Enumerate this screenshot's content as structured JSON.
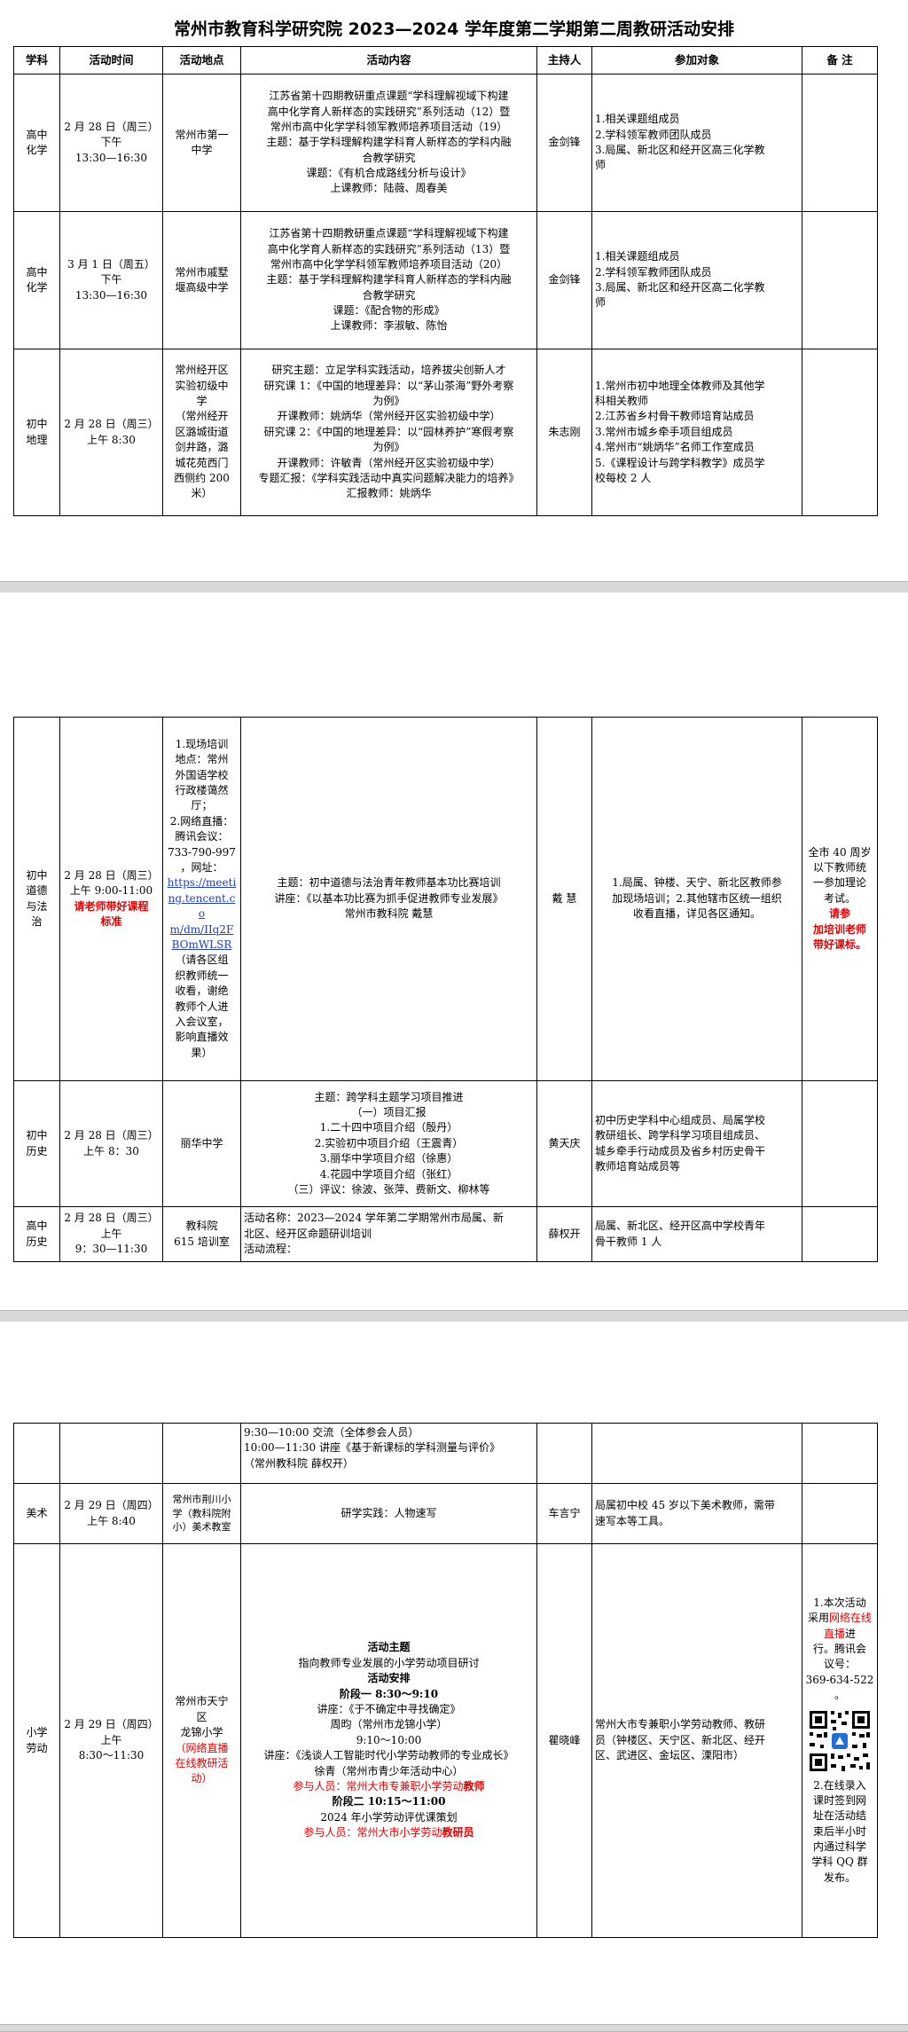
{
  "title": "常州市教育科学研究院 2023—2024 学年度第二学期第二周教研活动安排",
  "headers": [
    "学科",
    "活动时间",
    "活动地点",
    "活动内容",
    "主持人",
    "参加对象",
    "备 注"
  ],
  "rows": {
    "chem1": {
      "subject": [
        "高中",
        "化学"
      ],
      "time": [
        "2 月 28 日（周三）",
        "下午",
        "13:30—16:30"
      ],
      "place": [
        "常州市第一",
        "中学"
      ],
      "content": [
        "江苏省第十四期教研重点课题“学科理解视域下构建",
        "高中化学育人新样态的实践研究”系列活动（12）暨",
        "常州市高中化学学科领军教师培养项目活动（19）",
        "主题：基于学科理解构建学科育人新样态的学科内融",
        "合教学研究",
        "课题：《有机合成路线分析与设计》",
        "上课教师：陆薇、周春美"
      ],
      "host": "金剑锋",
      "participants": [
        "1.相关课题组成员",
        "2.学科领军教师团队成员",
        "3.局属、新北区和经开区高三化学教",
        "师"
      ]
    },
    "chem2": {
      "subject": [
        "高中",
        "化学"
      ],
      "time": [
        "3 月 1 日（周五）",
        "下午",
        "13:30—16:30"
      ],
      "place": [
        "常州市戚墅",
        "堰高级中学"
      ],
      "content": [
        "江苏省第十四期教研重点课题“学科理解视域下构建",
        "高中化学育人新样态的实践研究”系列活动（13）暨",
        "常州市高中化学学科领军教师培养项目活动（20）",
        "主题：基于学科理解构建学科育人新样态的学科内融",
        "合教学研究",
        "课题：《配合物的形成》",
        "上课教师：李淑敏、陈怡"
      ],
      "host": "金剑锋",
      "participants": [
        "1.相关课题组成员",
        "2.学科领军教师团队成员",
        "3.局属、新北区和经开区高二化学教",
        "师"
      ]
    },
    "geo": {
      "subject": [
        "初中",
        "地理"
      ],
      "time": [
        "2 月 28 日（周三）",
        "上午 8:30"
      ],
      "place": [
        "常州经开区",
        "实验初级中",
        "学",
        "（常州经开",
        "区潞城街道",
        "剑井路，潞",
        "城花苑西门",
        "西侧约 200",
        "米）"
      ],
      "content": [
        "研究主题：立足学科实践活动，培养拔尖创新人才",
        "研究课 1：《中国的地理差异：以“茅山茶海”野外考察",
        "为例》",
        "开课教师：姚炳华（常州经开区实验初级中学）",
        "研究课 2：《中国的地理差异：以“园林养护”寒假考察",
        "为例》",
        "开课教师：许敏青（常州经开区实验初级中学）",
        "专题汇报：《学科实践活动中真实问题解决能力的培养》",
        "汇报教师：姚炳华"
      ],
      "host": "朱志刚",
      "participants": [
        "1.常州市初中地理全体教师及其他学",
        "科相关教师",
        "2.江苏省乡村骨干教师培育站成员",
        "3.常州市城乡牵手项目组成员",
        "4.常州市“姚炳华”名师工作室成员",
        "5.《课程设计与跨学科教学》成员学",
        "校每校 2 人"
      ]
    },
    "moral": {
      "subject": [
        "初中",
        "道德",
        "与法",
        "治"
      ],
      "time": [
        "2 月 28 日（周三）",
        "上午 9:00-11:00"
      ],
      "time_red": [
        "请老师带好课程",
        "标准"
      ],
      "place_pre": [
        "1.现场培训",
        "地点：常州",
        "外国语学校",
        "行政楼蔼然",
        "厅；",
        "2.网络直播：",
        "腾讯会议：",
        "733-790-997",
        "，网址："
      ],
      "place_link": [
        "https://meeti",
        "ng.tencent.co",
        "m/dm/IIq2F",
        "BOmWLSR"
      ],
      "place_post": [
        "（请各区组",
        "织教师统一",
        "收看，谢绝",
        "教师个人进",
        "入会议室，",
        "影响直播效",
        "果）"
      ],
      "content": [
        "主题：初中道德与法治青年教师基本功比赛培训",
        "讲座：《以基本功比赛为抓手促进教师专业发展》",
        "常州市教科院  戴慧"
      ],
      "host": "戴  慧",
      "participants": [
        "1.局属、钟楼、天宁、新北区教师参",
        "加现场培训；2.其他辖市区统一组织",
        "收看直播，详见各区通知。"
      ],
      "note": [
        "全市 40 周岁",
        "以下教师统",
        "一参加理论",
        "考试。"
      ],
      "note_red": [
        "请参",
        "加培训老师",
        "带好课标。"
      ]
    },
    "history1": {
      "subject": [
        "初中",
        "历史"
      ],
      "time": [
        "2 月 28 日（周三）",
        "上午 8：30"
      ],
      "place": "丽华中学",
      "content": [
        "主题：跨学科主题学习项目推进",
        "（一）项目汇报",
        "1.二十四中项目介绍（殷丹）",
        "2.实验初中项目介绍（王震青）",
        "3.丽华中学项目介绍（徐惠）",
        "4.花园中学项目介绍（张红）",
        "（三）评议：徐波、张萍、费新文、柳林等"
      ],
      "host": "黄天庆",
      "participants": [
        "初中历史学科中心组成员、局属学校",
        "教研组长、跨学科学习项目组成员、",
        "城乡牵手行动成员及省乡村历史骨干",
        "教师培育站成员等"
      ]
    },
    "history2": {
      "subject": [
        "高中",
        "历史"
      ],
      "time": [
        "2 月 28 日（周三）",
        "上午",
        "9：30—11:30"
      ],
      "place": [
        "教科院",
        "615 培训室"
      ],
      "content": [
        "活动名称：2023—2024 学年第二学期常州市局属、新",
        "北区、经开区命题briefing"
      ],
      "host": "薛权开",
      "participants": [
        "局属、新北区、经开区高中学校青年",
        "骨干教师 1 人"
      ]
    },
    "history2_cont": [
      "9:30—10:00  交流（全体参会人员）",
      "10:00—11:30 讲座《基于新课标的学科测量与评价》",
      "（常州教科院  薛权开）"
    ],
    "art": {
      "subject": "美术",
      "time": [
        "2 月 29 日（周四）",
        "上午 8:40"
      ],
      "place": [
        "常州市荆川小",
        "学（教科院附",
        "小）美术教室"
      ],
      "content": "研学实践：人物速写",
      "host": "车言宁",
      "participants": [
        "局属初中校 45 岁以下美术教师，需带",
        "速写本等工具。"
      ]
    },
    "labor": {
      "subject": [
        "小学",
        "劳动"
      ],
      "time": [
        "2 月 29 日（周四）",
        "上午",
        "8:30～11:30"
      ],
      "place": [
        "常州市天宁",
        "区",
        "龙锦小学"
      ],
      "place_red": [
        "（网络直播",
        "在线教研活",
        "动）"
      ],
      "content": {
        "h1": "活动主题",
        "theme": "指向教师专业发展的小学劳动项目研讨",
        "h2": "活动安排",
        "stage1": "阶段一 8:30～9:10",
        "l1": "讲座：《于不确定中寻找确定》",
        "l2": "周昀（常州市龙锦小学）",
        "l3": "9:10～10:00",
        "l4": "讲座：《浅谈人工智能时代小学劳动教师的专业成长》",
        "l5": "徐青（常州市青少年活动中心）",
        "r1": "参与人员：常州大市专兼职小学劳动",
        "r1b": "教师",
        "stage2": "阶段二 10:15～11:00",
        "l6": "2024 年小学劳动评优课策划",
        "r2": "参与人员：常州大市小学劳动",
        "r2b": "教研员"
      },
      "host": "瞿晓峰",
      "participants": [
        "常州大市专兼职小学劳动教师、教研",
        "员（钟楼区、天宁区、新北区、经开",
        "区、武进区、金坛区、溧阳市）"
      ],
      "note1": [
        "1.本次活动",
        "采用"
      ],
      "note1_red": "网络在线直播",
      "note1_b": [
        "进",
        "行。腾讯会",
        "议号：",
        "369-634-522",
        "。"
      ],
      "note2": [
        "2.在线录入",
        "课时签到网",
        "址在活动结",
        "束后半小时",
        "内通过科学",
        "学科 QQ 群",
        "发布。"
      ]
    }
  }
}
